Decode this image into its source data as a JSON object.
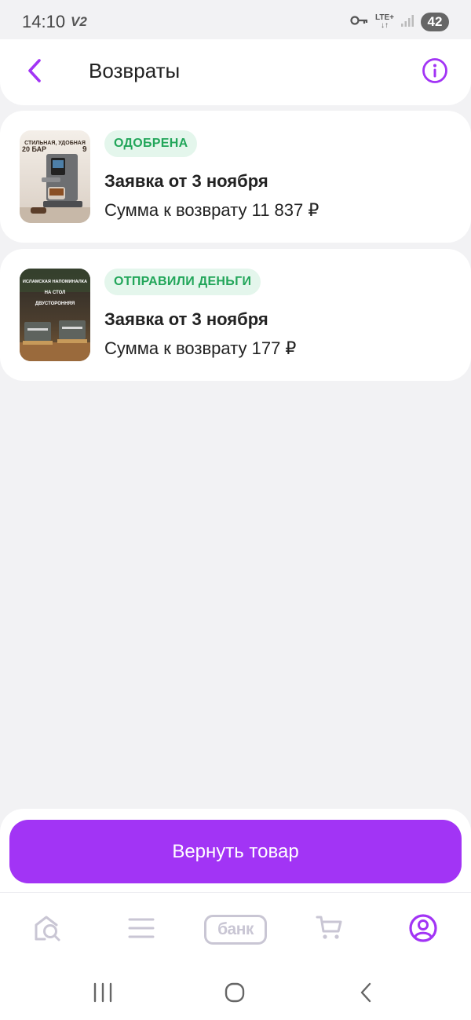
{
  "status_bar": {
    "time": "14:10",
    "carrier": "V2",
    "network_top": "LTE+",
    "network_bottom": "↓↑",
    "battery": "42"
  },
  "header": {
    "title": "Возвраты",
    "back_icon": "chevron-left-icon",
    "info_icon": "info-icon"
  },
  "returns": [
    {
      "status": "ОДОБРЕНА",
      "title": "Заявка от 3 ноября",
      "sum": "Сумма к возврату 11 837 ₽",
      "image": "coffee-machine-image",
      "image_text": [
        "СТИЛЬНАЯ, УДОБНАЯ",
        "20 БАР",
        "9"
      ]
    },
    {
      "status": "ОТПРАВИЛИ ДЕНЬГИ",
      "title": "Заявка от 3 ноября",
      "sum": "Сумма к возврату 177 ₽",
      "image": "table-sign-image",
      "image_text": [
        "ИСЛАМСКАЯ НАПОМИНАЛКА",
        "НА СТОЛ",
        "ДВУСТОРОННЯЯ"
      ]
    }
  ],
  "action": {
    "button_label": "Вернуть товар"
  },
  "bottom_nav": {
    "items": [
      {
        "icon": "search-home-icon",
        "active": false
      },
      {
        "icon": "catalog-menu-icon",
        "active": false
      },
      {
        "icon": "bank-icon",
        "label": "банк",
        "active": false
      },
      {
        "icon": "cart-icon",
        "active": false
      },
      {
        "icon": "profile-icon",
        "active": true
      }
    ]
  },
  "colors": {
    "accent": "#a234f5",
    "status_green": "#22a65a",
    "status_green_bg": "#e4f6ec",
    "nav_inactive": "#c9c6d4"
  }
}
